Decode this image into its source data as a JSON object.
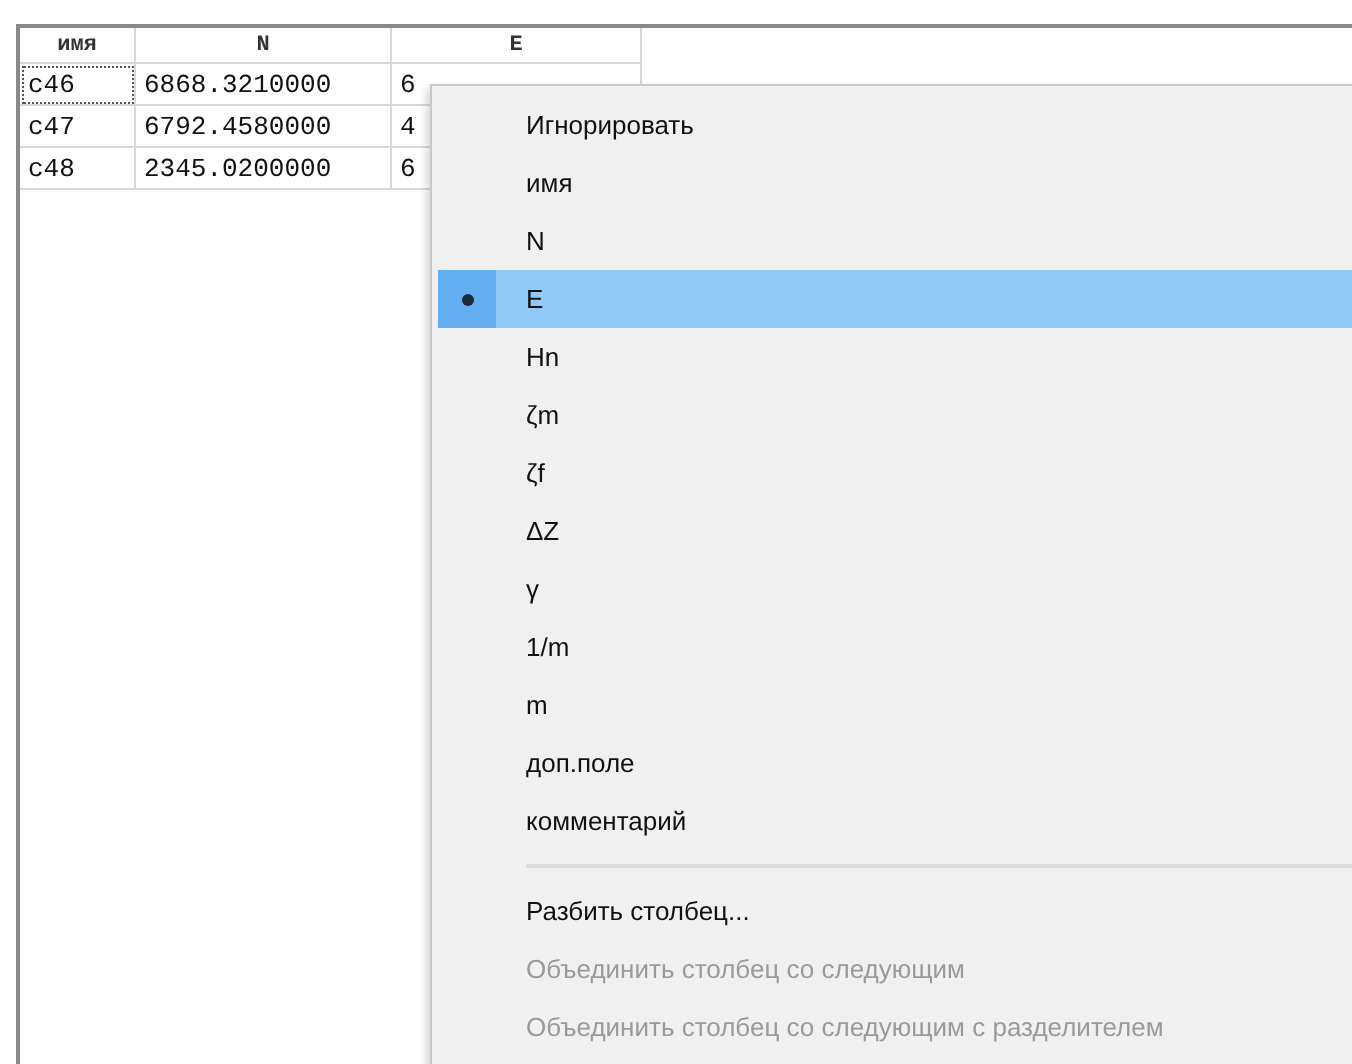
{
  "table": {
    "columns": [
      "имя",
      "N",
      "E"
    ],
    "rows": [
      {
        "cells": [
          "c46",
          "6868.3210000",
          "6"
        ],
        "focused": true
      },
      {
        "cells": [
          "c47",
          "6792.4580000",
          "4"
        ],
        "focused": false
      },
      {
        "cells": [
          "c48",
          "2345.0200000",
          "6"
        ],
        "focused": false
      }
    ]
  },
  "context_menu": {
    "column_types": [
      {
        "label": "Игнорировать",
        "selected": false
      },
      {
        "label": "имя",
        "selected": false
      },
      {
        "label": "N",
        "selected": false
      },
      {
        "label": "E",
        "selected": true
      },
      {
        "label": "Hn",
        "selected": false
      },
      {
        "label": "ζm",
        "selected": false
      },
      {
        "label": "ζf",
        "selected": false
      },
      {
        "label": "ΔZ",
        "selected": false
      },
      {
        "label": "γ",
        "selected": false
      },
      {
        "label": "1/m",
        "selected": false
      },
      {
        "label": "m",
        "selected": false
      },
      {
        "label": "доп.поле",
        "selected": false
      },
      {
        "label": "комментарий",
        "selected": false
      }
    ],
    "actions": [
      {
        "label": "Разбить столбец...",
        "disabled": false
      },
      {
        "label": "Объединить столбец со следующим",
        "disabled": true
      },
      {
        "label": "Объединить столбец со следующим с разделителем",
        "disabled": true
      }
    ]
  }
}
